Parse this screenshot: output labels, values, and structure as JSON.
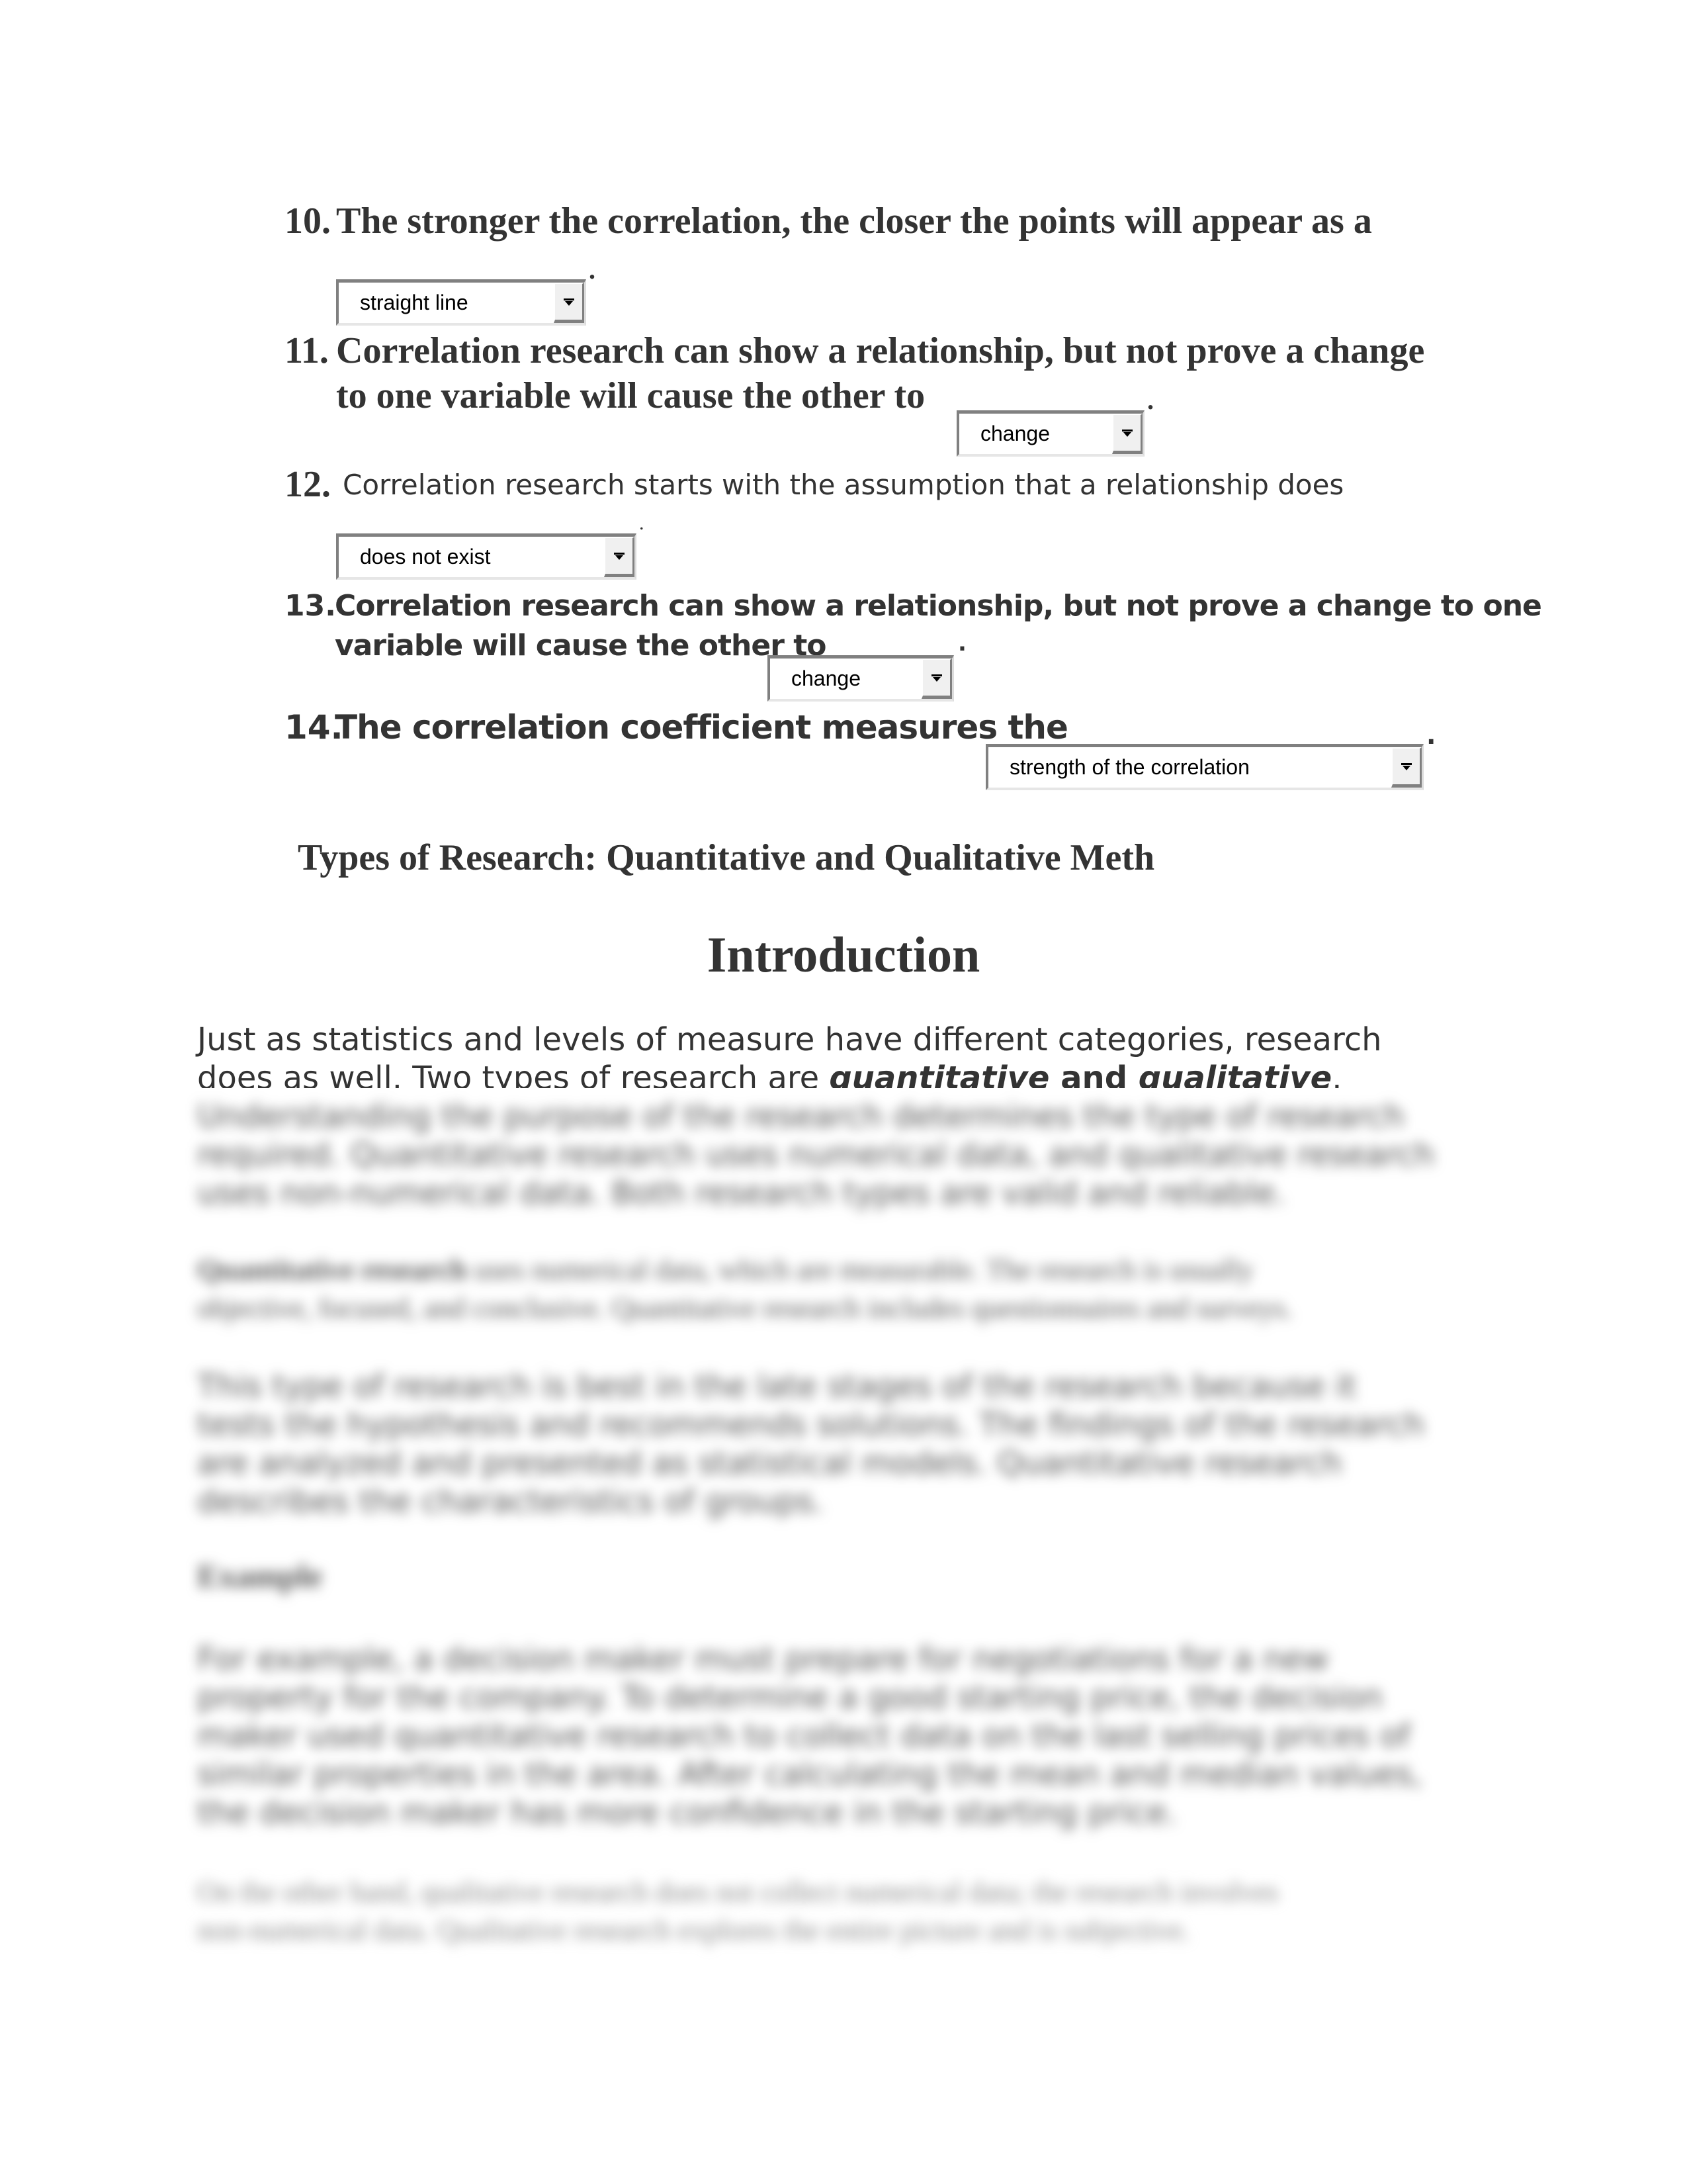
{
  "questions": [
    {
      "number": "10.",
      "lines": [
        "The stronger the correlation, the closer the points will appear as a"
      ],
      "select_value": "straight line",
      "end_punct": "."
    },
    {
      "number": "11.",
      "lines": [
        "Correlation research can show a relationship, but not prove a change",
        "to one variable will cause the other to"
      ],
      "select_value": "change",
      "end_punct": "."
    },
    {
      "number": "12.",
      "lines": [
        "Correlation research starts with the assumption that a relationship does"
      ],
      "select_value": "does not exist",
      "end_punct": "."
    },
    {
      "number": "13.",
      "lines": [
        "Correlation research can show a relationship, but not prove a change to one",
        "variable will cause the other to"
      ],
      "select_value": "change",
      "end_punct": "."
    },
    {
      "number": "14.",
      "lines": [
        "The correlation coefficient measures the"
      ],
      "select_value": "strength of the correlation",
      "end_punct": "."
    }
  ],
  "section": {
    "title": "Types of Research: Quantitative and Qualitative Meth",
    "heading": "Introduction",
    "intro": {
      "line1": "Just as statistics and levels of measure have different categories, research",
      "line2_prefix": "does as well. Two types of research are ",
      "emph1": "quantitative",
      "emph_and": " and ",
      "emph2": "qualitative",
      "line2_suffix": "."
    },
    "blurred": {
      "p1": [
        "Understanding the purpose of the research determines the type of research",
        "required. Quantitative research uses numerical data, and qualitative research",
        "uses non-numerical data. Both research types are valid and reliable."
      ],
      "p2_bold": "Quantitative research",
      "p2": [
        " uses numerical data, which are measurable. The research is usually",
        "objective, focused, and conclusive. Quantitative research includes questionnaires and surveys."
      ],
      "p3": [
        "This type of research is best in the late stages of the research because it",
        "tests the hypothesis and recommends solutions. The findings of the research",
        "are analyzed and presented as statistical models. Quantitative research",
        "describes the characteristics of groups."
      ],
      "example_heading": "Example",
      "p4": [
        "For example, a decision maker must prepare for negotiations for a new",
        "property for the company. To determine a good starting price, the decision",
        "maker used quantitative research to collect data on the last selling prices of",
        "similar properties in the area. After calculating the mean and median values,",
        "the decision maker has more confidence in the starting price."
      ],
      "p5": [
        "On the other hand, qualitative research does not collect numerical data; the research involves",
        "non-numerical data. Qualitative research explores the entire picture and is subjective."
      ]
    }
  },
  "icons": {
    "select_arrow": "chevron-down-icon"
  },
  "colors": {
    "text": "#333333",
    "select_border_dark": "#808080",
    "select_button": "#f0f0f0"
  }
}
